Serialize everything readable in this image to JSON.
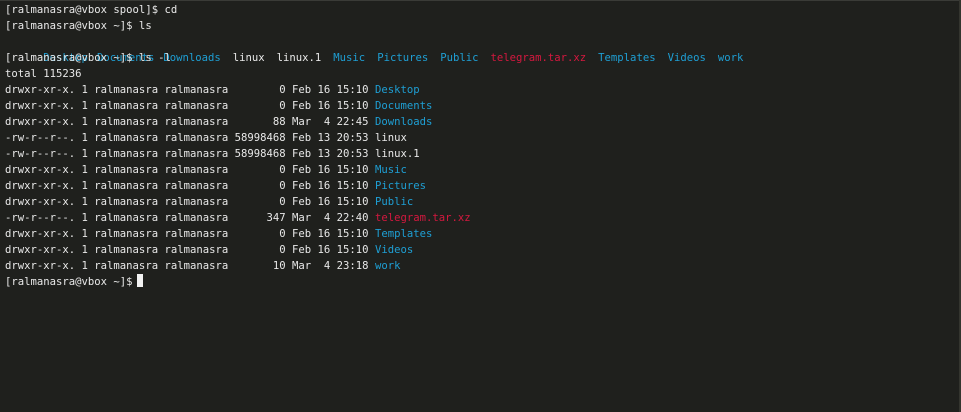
{
  "colors": {
    "background": "#1f201d",
    "foreground": "#e8e8e8",
    "directory": "#1f9fd4",
    "archive": "#d4183f"
  },
  "terminal": {
    "line1": "[ralmanasra@vbox spool]$ cd",
    "line2": "[ralmanasra@vbox ~]$ ls",
    "ls_items": [
      {
        "name": "Desktop",
        "kind": "dir"
      },
      {
        "name": "Documents",
        "kind": "dir"
      },
      {
        "name": "Downloads",
        "kind": "dir"
      },
      {
        "name": "linux",
        "kind": "file"
      },
      {
        "name": "linux.1",
        "kind": "file"
      },
      {
        "name": "Music",
        "kind": "dir"
      },
      {
        "name": "Pictures",
        "kind": "dir"
      },
      {
        "name": "Public",
        "kind": "dir"
      },
      {
        "name": "telegram.tar.xz",
        "kind": "archive"
      },
      {
        "name": "Templates",
        "kind": "dir"
      },
      {
        "name": "Videos",
        "kind": "dir"
      },
      {
        "name": "work",
        "kind": "dir"
      }
    ],
    "line3": "[ralmanasra@vbox ~]$ ls -l",
    "total": "total 115236",
    "long_rows": [
      {
        "prefix": "drwxr-xr-x. 1 ralmanasra ralmanasra        0 Feb 16 15:10 ",
        "name": "Desktop",
        "kind": "dir"
      },
      {
        "prefix": "drwxr-xr-x. 1 ralmanasra ralmanasra        0 Feb 16 15:10 ",
        "name": "Documents",
        "kind": "dir"
      },
      {
        "prefix": "drwxr-xr-x. 1 ralmanasra ralmanasra       88 Mar  4 22:45 ",
        "name": "Downloads",
        "kind": "dir"
      },
      {
        "prefix": "-rw-r--r--. 1 ralmanasra ralmanasra 58998468 Feb 13 20:53 ",
        "name": "linux",
        "kind": "file"
      },
      {
        "prefix": "-rw-r--r--. 1 ralmanasra ralmanasra 58998468 Feb 13 20:53 ",
        "name": "linux.1",
        "kind": "file"
      },
      {
        "prefix": "drwxr-xr-x. 1 ralmanasra ralmanasra        0 Feb 16 15:10 ",
        "name": "Music",
        "kind": "dir"
      },
      {
        "prefix": "drwxr-xr-x. 1 ralmanasra ralmanasra        0 Feb 16 15:10 ",
        "name": "Pictures",
        "kind": "dir"
      },
      {
        "prefix": "drwxr-xr-x. 1 ralmanasra ralmanasra        0 Feb 16 15:10 ",
        "name": "Public",
        "kind": "dir"
      },
      {
        "prefix": "-rw-r--r--. 1 ralmanasra ralmanasra      347 Mar  4 22:40 ",
        "name": "telegram.tar.xz",
        "kind": "archive"
      },
      {
        "prefix": "drwxr-xr-x. 1 ralmanasra ralmanasra        0 Feb 16 15:10 ",
        "name": "Templates",
        "kind": "dir"
      },
      {
        "prefix": "drwxr-xr-x. 1 ralmanasra ralmanasra        0 Feb 16 15:10 ",
        "name": "Videos",
        "kind": "dir"
      },
      {
        "prefix": "drwxr-xr-x. 1 ralmanasra ralmanasra       10 Mar  4 23:18 ",
        "name": "work",
        "kind": "dir"
      }
    ],
    "final_prompt": "[ralmanasra@vbox ~]$"
  }
}
